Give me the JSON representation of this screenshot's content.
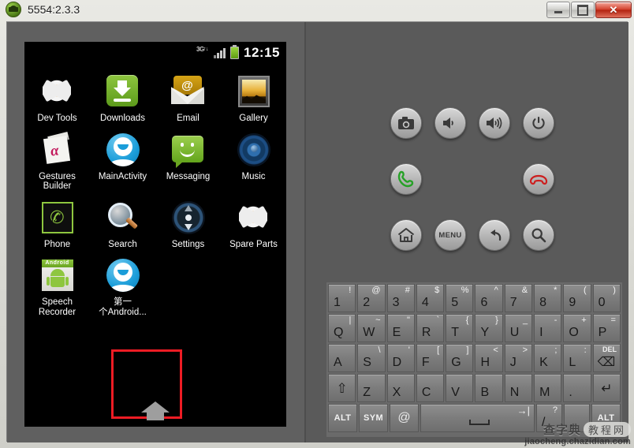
{
  "window": {
    "title": "5554:2.3.3",
    "icon": "android-head-icon",
    "controls": {
      "minimize": "minimize-button",
      "maximize": "maximize-button",
      "close_label": "✕"
    }
  },
  "status_bar": {
    "network_label": "3G",
    "network_arrows": "↑↓",
    "signal": "signal-bars-icon",
    "battery": "battery-icon",
    "time": "12:15"
  },
  "apps": [
    [
      {
        "label": "Dev Tools",
        "icon": "gear-icon"
      },
      {
        "label": "Downloads",
        "icon": "download-icon"
      },
      {
        "label": "Email",
        "icon": "envelope-at-icon"
      },
      {
        "label": "Gallery",
        "icon": "photo-frame-icon"
      }
    ],
    [
      {
        "label": "Gestures\nBuilder",
        "icon": "gesture-pages-icon"
      },
      {
        "label": "MainActivity",
        "icon": "blue-person-icon"
      },
      {
        "label": "Messaging",
        "icon": "green-speech-bubble-icon"
      },
      {
        "label": "Music",
        "icon": "speaker-icon"
      }
    ],
    [
      {
        "label": "Phone",
        "icon": "green-handset-icon"
      },
      {
        "label": "Search",
        "icon": "magnifier-icon"
      },
      {
        "label": "Settings",
        "icon": "compass-dial-icon"
      },
      {
        "label": "Spare Parts",
        "icon": "gear-icon"
      }
    ],
    [
      {
        "label": "Speech\nRecorder",
        "icon": "android-robot-icon"
      },
      {
        "label": "第一\n个Android...",
        "icon": "blue-person-icon",
        "selected": true
      },
      {
        "label": "",
        "icon": ""
      },
      {
        "label": "",
        "icon": ""
      }
    ]
  ],
  "selection_color": "#ed1c24",
  "dock": {
    "home_icon": "home-icon"
  },
  "emulator_controls": {
    "row1": [
      {
        "name": "camera-button",
        "icon": "camera-icon"
      },
      {
        "name": "volume-down-button",
        "icon": "speaker-low-icon"
      },
      {
        "name": "volume-up-button",
        "icon": "speaker-high-icon"
      },
      {
        "name": "power-button",
        "icon": "power-icon"
      }
    ],
    "row2": [
      {
        "name": "call-button",
        "icon": "green-phone-icon"
      },
      {
        "name": "dpad",
        "icon": "dpad-icon"
      },
      {
        "name": "end-call-button",
        "icon": "red-phone-icon"
      }
    ],
    "row3": [
      {
        "name": "home-button",
        "icon": "home-icon",
        "label": ""
      },
      {
        "name": "menu-button",
        "icon": "",
        "label": "MENU"
      },
      {
        "name": "back-button",
        "icon": "back-arrow-icon",
        "label": ""
      },
      {
        "name": "search-button",
        "icon": "magnifier-icon",
        "label": ""
      }
    ],
    "led": "red-led-indicator"
  },
  "keyboard": {
    "row1": [
      {
        "main": "1",
        "alt": "!"
      },
      {
        "main": "2",
        "alt": "@"
      },
      {
        "main": "3",
        "alt": "#"
      },
      {
        "main": "4",
        "alt": "$"
      },
      {
        "main": "5",
        "alt": "%"
      },
      {
        "main": "6",
        "alt": "^"
      },
      {
        "main": "7",
        "alt": "&"
      },
      {
        "main": "8",
        "alt": "*"
      },
      {
        "main": "9",
        "alt": "("
      },
      {
        "main": "0",
        "alt": ")"
      }
    ],
    "row2": [
      {
        "main": "Q",
        "alt": "|"
      },
      {
        "main": "W",
        "alt": "~"
      },
      {
        "main": "E",
        "alt": "\""
      },
      {
        "main": "R",
        "alt": "`"
      },
      {
        "main": "T",
        "alt": "{"
      },
      {
        "main": "Y",
        "alt": "}"
      },
      {
        "main": "U",
        "alt": "_"
      },
      {
        "main": "I",
        "alt": "-"
      },
      {
        "main": "O",
        "alt": "+"
      },
      {
        "main": "P",
        "alt": "="
      }
    ],
    "row3": [
      {
        "main": "A",
        "alt": ""
      },
      {
        "main": "S",
        "alt": "\\"
      },
      {
        "main": "D",
        "alt": "'"
      },
      {
        "main": "F",
        "alt": "["
      },
      {
        "main": "G",
        "alt": "]"
      },
      {
        "main": "H",
        "alt": "<"
      },
      {
        "main": "J",
        "alt": ">"
      },
      {
        "main": "K",
        "alt": ";"
      },
      {
        "main": "L",
        "alt": ":"
      }
    ],
    "delete_key": {
      "label": "DEL",
      "glyph": "⌫"
    },
    "row4": [
      {
        "main": "Z",
        "alt": ""
      },
      {
        "main": "X",
        "alt": ""
      },
      {
        "main": "C",
        "alt": ""
      },
      {
        "main": "V",
        "alt": ""
      },
      {
        "main": "B",
        "alt": ""
      },
      {
        "main": "N",
        "alt": ""
      },
      {
        "main": "M",
        "alt": ""
      },
      {
        "main": ".",
        "alt": ""
      }
    ],
    "shift_key": {
      "glyph": "⇧"
    },
    "enter_key": {
      "glyph": "↵"
    },
    "row5": {
      "alt_left": "ALT",
      "sym": "SYM",
      "at": "@",
      "space_tab": "→|",
      "slash": {
        "main": "/",
        "alt": "?"
      },
      "comma": ",",
      "alt_right": "ALT"
    }
  },
  "watermark": {
    "brand": "查字典",
    "tag": "教程网",
    "url": "jiaocheng.chazidian.com"
  }
}
